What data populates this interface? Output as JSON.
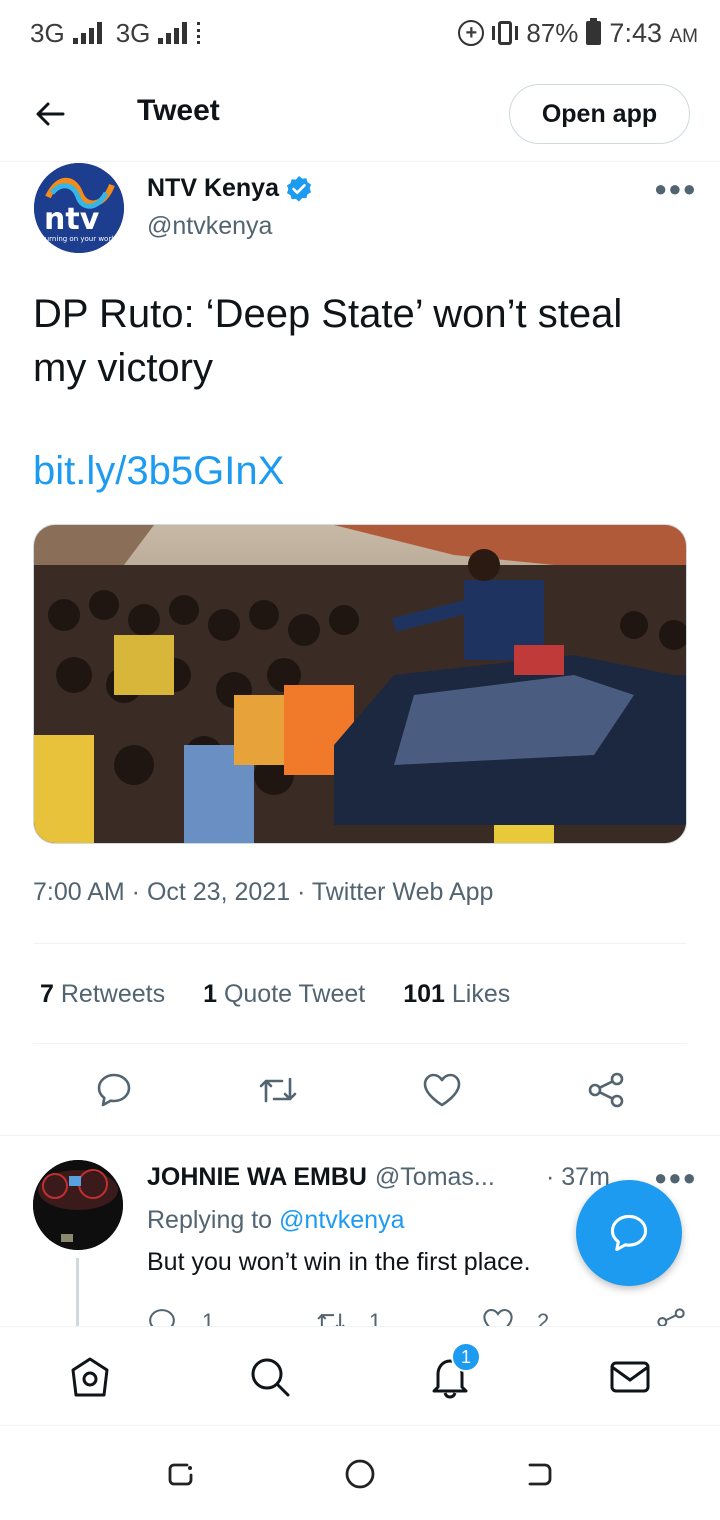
{
  "status_bar": {
    "network1": "3G",
    "network2": "3G",
    "battery": "87%",
    "time": "7:43",
    "ampm": "AM"
  },
  "header": {
    "title": "Tweet",
    "open_app": "Open app"
  },
  "tweet": {
    "author_name": "NTV Kenya",
    "author_handle": "@ntvkenya",
    "avatar_text": "ntv",
    "avatar_tagline": "turning on your world",
    "text": "DP Ruto: ‘Deep State’ won’t steal my victory",
    "link": "bit.ly/3b5GInX",
    "meta": "7:00 AM · Oct 23, 2021 · Twitter Web App",
    "stats": {
      "retweets_count": "7",
      "retweets_label": "Retweets",
      "quotes_count": "1",
      "quotes_label": "Quote Tweet",
      "likes_count": "101",
      "likes_label": "Likes"
    }
  },
  "reply": {
    "author_name": "JOHNIE WA EMBU",
    "author_handle": "@Tomas...",
    "time": "· 37m",
    "replying_prefix": "Replying to",
    "replying_to": "@ntvkenya",
    "text": "But you won’t win in the first place.",
    "reply_count": "1",
    "retweet_count": "1",
    "like_count": "2"
  },
  "notifications_badge": "1",
  "colors": {
    "accent": "#1d9bf0",
    "text": "#0f1419",
    "muted": "#536471",
    "border": "#cfd9de"
  }
}
